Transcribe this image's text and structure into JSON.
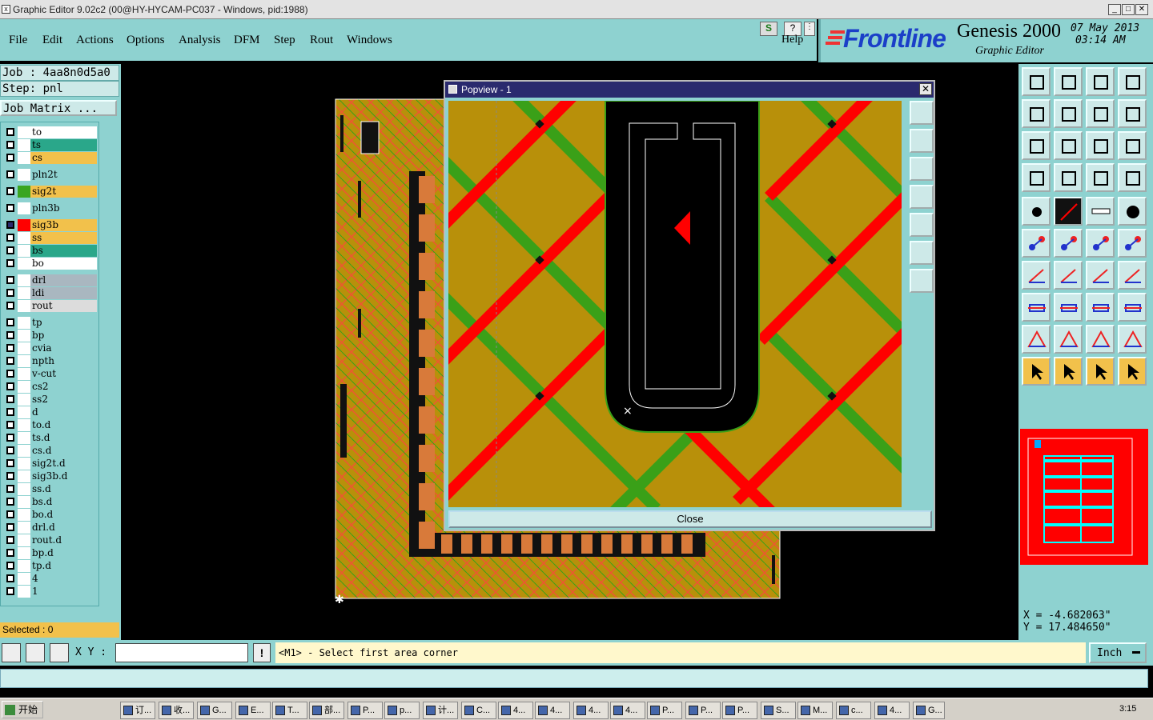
{
  "window": {
    "title": "Graphic Editor 9.02c2 (00@HY-HYCAM-PC037 - Windows, pid:1988)",
    "min": "_",
    "max": "□",
    "close": "✕"
  },
  "menu": [
    {
      "label": "File"
    },
    {
      "label": "Edit"
    },
    {
      "label": "Actions"
    },
    {
      "label": "Options"
    },
    {
      "label": "Analysis"
    },
    {
      "label": "DFM"
    },
    {
      "label": "Step"
    },
    {
      "label": "Rout"
    },
    {
      "label": "Windows"
    }
  ],
  "help": {
    "label": "Help",
    "s_icon": "S",
    "q_icon": "?"
  },
  "brand": {
    "logo": "Frontline",
    "product": "Genesis 2000",
    "subtitle": "Graphic Editor",
    "date": "07 May 2013",
    "time": "03:14 AM"
  },
  "job": {
    "job_line": "Job : 4aa8n0d5a0",
    "step_line": "Step: pnl",
    "matrix_button": "Job Matrix ..."
  },
  "layers": [
    {
      "name": "to",
      "color": "#ffffff",
      "swatch": "#ffffff"
    },
    {
      "name": "ts",
      "color": "#2aa78a",
      "swatch": "#ffffff"
    },
    {
      "name": "cs",
      "color": "#f2c14b",
      "swatch": "#ffffff"
    },
    {
      "name": "pln2t",
      "color": "#8ed2d0",
      "swatch": "#ffffff"
    },
    {
      "name": "sig2t",
      "color": "#f2c14b",
      "swatch": "#39a520"
    },
    {
      "name": "pln3b",
      "color": "#8ed2d0",
      "swatch": "#ffffff"
    },
    {
      "name": "sig3b",
      "color": "#f2c14b",
      "swatch": "#ff0000",
      "active": true
    },
    {
      "name": "ss",
      "color": "#f2c14b",
      "swatch": "#ffffff"
    },
    {
      "name": "bs",
      "color": "#2aa78a",
      "swatch": "#ffffff"
    },
    {
      "name": "bo",
      "color": "#ffffff",
      "swatch": "#ffffff"
    },
    {
      "name": "drl",
      "color": "#a9b7c0",
      "swatch": "#ffffff"
    },
    {
      "name": "ldi",
      "color": "#a9b7c0",
      "swatch": "#ffffff"
    },
    {
      "name": "rout",
      "color": "#dcdcdc",
      "swatch": "#ffffff"
    },
    {
      "name": "tp",
      "color": "#8ed2d0",
      "swatch": "#ffffff"
    },
    {
      "name": "bp",
      "color": "#8ed2d0",
      "swatch": "#ffffff"
    },
    {
      "name": "cvia",
      "color": "#8ed2d0",
      "swatch": "#ffffff"
    },
    {
      "name": "npth",
      "color": "#8ed2d0",
      "swatch": "#ffffff"
    },
    {
      "name": "v-cut",
      "color": "#8ed2d0",
      "swatch": "#ffffff"
    },
    {
      "name": "cs2",
      "color": "#8ed2d0",
      "swatch": "#ffffff"
    },
    {
      "name": "ss2",
      "color": "#8ed2d0",
      "swatch": "#ffffff"
    },
    {
      "name": "d",
      "color": "#8ed2d0",
      "swatch": "#ffffff"
    },
    {
      "name": "to.d",
      "color": "#8ed2d0",
      "swatch": "#ffffff"
    },
    {
      "name": "ts.d",
      "color": "#8ed2d0",
      "swatch": "#ffffff"
    },
    {
      "name": "cs.d",
      "color": "#8ed2d0",
      "swatch": "#ffffff"
    },
    {
      "name": "sig2t.d",
      "color": "#8ed2d0",
      "swatch": "#ffffff"
    },
    {
      "name": "sig3b.d",
      "color": "#8ed2d0",
      "swatch": "#ffffff"
    },
    {
      "name": "ss.d",
      "color": "#8ed2d0",
      "swatch": "#ffffff"
    },
    {
      "name": "bs.d",
      "color": "#8ed2d0",
      "swatch": "#ffffff"
    },
    {
      "name": "bo.d",
      "color": "#8ed2d0",
      "swatch": "#ffffff"
    },
    {
      "name": "drl.d",
      "color": "#8ed2d0",
      "swatch": "#ffffff"
    },
    {
      "name": "rout.d",
      "color": "#8ed2d0",
      "swatch": "#ffffff"
    },
    {
      "name": "bp.d",
      "color": "#8ed2d0",
      "swatch": "#ffffff"
    },
    {
      "name": "tp.d",
      "color": "#8ed2d0",
      "swatch": "#ffffff"
    },
    {
      "name": "4",
      "color": "#8ed2d0",
      "swatch": "#ffffff"
    },
    {
      "name": "1",
      "color": "#8ed2d0",
      "swatch": "#ffffff"
    }
  ],
  "selected": "Selected : 0",
  "popview": {
    "title": "Popview - 1",
    "close_label": "Close",
    "x": "✕"
  },
  "coords": {
    "x": "X = -4.682063\"",
    "y": "Y = 17.484650\""
  },
  "bottom": {
    "xy_label": "X Y :",
    "xy_value": "",
    "prompt": "<M1> - Select first area corner",
    "units": "Inch",
    "alert": "!"
  },
  "taskbar": {
    "start": "开始",
    "clock": "3:15",
    "tasks": [
      "订...",
      "收...",
      "G...",
      "E...",
      "T...",
      "部...",
      "P...",
      "p...",
      "计...",
      "C...",
      "4...",
      "4...",
      "4...",
      "4...",
      "P...",
      "P...",
      "P...",
      "S...",
      "M...",
      "c...",
      "4...",
      "G..."
    ]
  },
  "colors": {
    "panel": "#8ed2d0",
    "copper": "#b8900a",
    "red": "#ff0000",
    "green": "#3aa018"
  }
}
